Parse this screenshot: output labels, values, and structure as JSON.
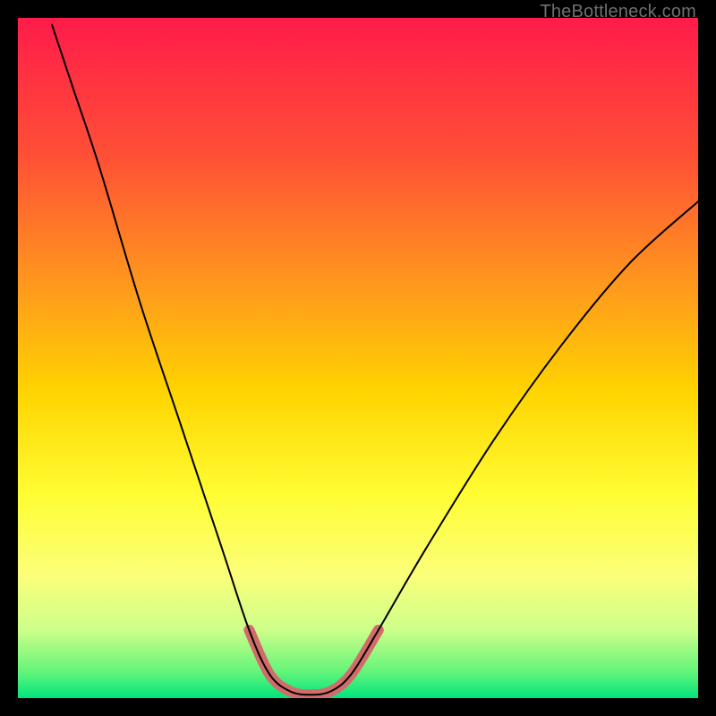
{
  "watermark": "TheBottleneck.com",
  "chart_data": {
    "type": "line",
    "title": "",
    "xlabel": "",
    "ylabel": "",
    "xlim": [
      0,
      100
    ],
    "ylim": [
      0,
      100
    ],
    "grid": false,
    "legend": false,
    "annotations": [],
    "background_gradient_stops": [
      {
        "offset": 0.0,
        "color": "#ff1b4a"
      },
      {
        "offset": 0.2,
        "color": "#ff4f36"
      },
      {
        "offset": 0.4,
        "color": "#ff9b1c"
      },
      {
        "offset": 0.55,
        "color": "#ffd400"
      },
      {
        "offset": 0.7,
        "color": "#fffd33"
      },
      {
        "offset": 0.82,
        "color": "#fbff7a"
      },
      {
        "offset": 0.9,
        "color": "#ccff8a"
      },
      {
        "offset": 0.96,
        "color": "#66f57a"
      },
      {
        "offset": 1.0,
        "color": "#00e47d"
      }
    ],
    "series": [
      {
        "name": "bottleneck-curve",
        "color": "#000000",
        "stroke_width": 2,
        "points": [
          {
            "x": 5.0,
            "y": 99.0
          },
          {
            "x": 8.0,
            "y": 90.0
          },
          {
            "x": 12.0,
            "y": 78.0
          },
          {
            "x": 18.0,
            "y": 58.0
          },
          {
            "x": 24.0,
            "y": 40.0
          },
          {
            "x": 30.0,
            "y": 22.0
          },
          {
            "x": 34.0,
            "y": 10.0
          },
          {
            "x": 37.0,
            "y": 3.5
          },
          {
            "x": 40.0,
            "y": 1.0
          },
          {
            "x": 43.0,
            "y": 0.5
          },
          {
            "x": 46.0,
            "y": 1.0
          },
          {
            "x": 49.0,
            "y": 3.5
          },
          {
            "x": 53.0,
            "y": 10.0
          },
          {
            "x": 60.0,
            "y": 22.0
          },
          {
            "x": 70.0,
            "y": 38.0
          },
          {
            "x": 80.0,
            "y": 52.0
          },
          {
            "x": 90.0,
            "y": 64.0
          },
          {
            "x": 100.0,
            "y": 73.0
          }
        ]
      },
      {
        "name": "valley-highlight",
        "color": "#d36b6b",
        "stroke_width": 12,
        "points": [
          {
            "x": 34.0,
            "y": 10.0
          },
          {
            "x": 37.0,
            "y": 3.5
          },
          {
            "x": 40.0,
            "y": 1.0
          },
          {
            "x": 43.0,
            "y": 0.5
          },
          {
            "x": 46.0,
            "y": 1.0
          },
          {
            "x": 49.0,
            "y": 3.5
          },
          {
            "x": 53.0,
            "y": 10.0
          }
        ]
      }
    ]
  }
}
